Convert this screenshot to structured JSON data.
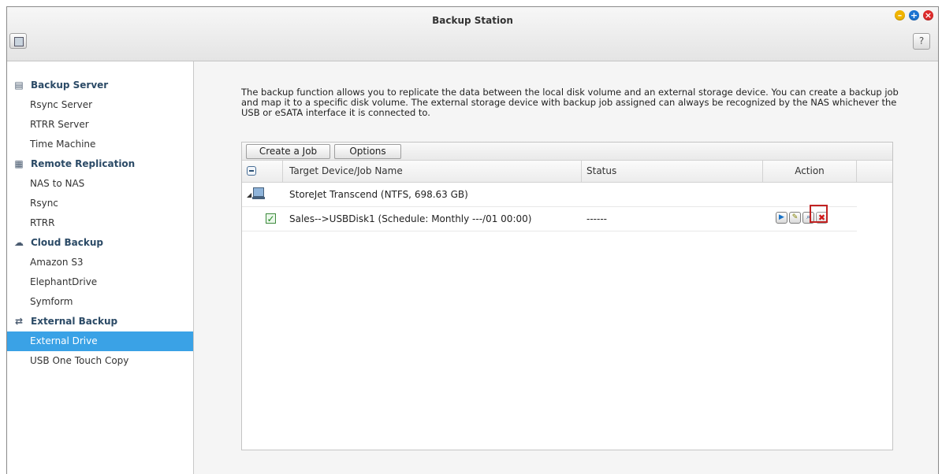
{
  "window": {
    "title": "Backup Station",
    "help_label": "?"
  },
  "sidebar": {
    "groups": [
      {
        "label": "Backup Server",
        "icon": "server-icon",
        "items": [
          {
            "label": "Rsync Server"
          },
          {
            "label": "RTRR Server"
          },
          {
            "label": "Time Machine"
          }
        ]
      },
      {
        "label": "Remote Replication",
        "icon": "replication-icon",
        "items": [
          {
            "label": "NAS to NAS"
          },
          {
            "label": "Rsync"
          },
          {
            "label": "RTRR"
          }
        ]
      },
      {
        "label": "Cloud Backup",
        "icon": "cloud-icon",
        "items": [
          {
            "label": "Amazon S3"
          },
          {
            "label": "ElephantDrive"
          },
          {
            "label": "Symform"
          }
        ]
      },
      {
        "label": "External Backup",
        "icon": "sync-icon",
        "items": [
          {
            "label": "External Drive",
            "selected": true
          },
          {
            "label": "USB One Touch Copy"
          }
        ]
      }
    ]
  },
  "main": {
    "description": "The backup function allows you to replicate the data between the local disk volume and an external storage device. You can create a backup job and map it to a specific disk volume. The external storage device with backup job assigned can always be recognized by the NAS whichever the USB or eSATA interface it is connected to.",
    "toolbar": {
      "create_label": "Create a Job",
      "options_label": "Options"
    },
    "table": {
      "columns": {
        "target": "Target Device/Job Name",
        "status": "Status",
        "action": "Action"
      },
      "device": {
        "name": "StoreJet Transcend (NTFS, 698.63 GB)"
      },
      "job": {
        "name": "Sales-->USBDisk1 (Schedule: Monthly ---/01 00:00)",
        "status": "------"
      }
    }
  },
  "colors": {
    "accent": "#3aa2e6",
    "highlight": "#c22222"
  }
}
